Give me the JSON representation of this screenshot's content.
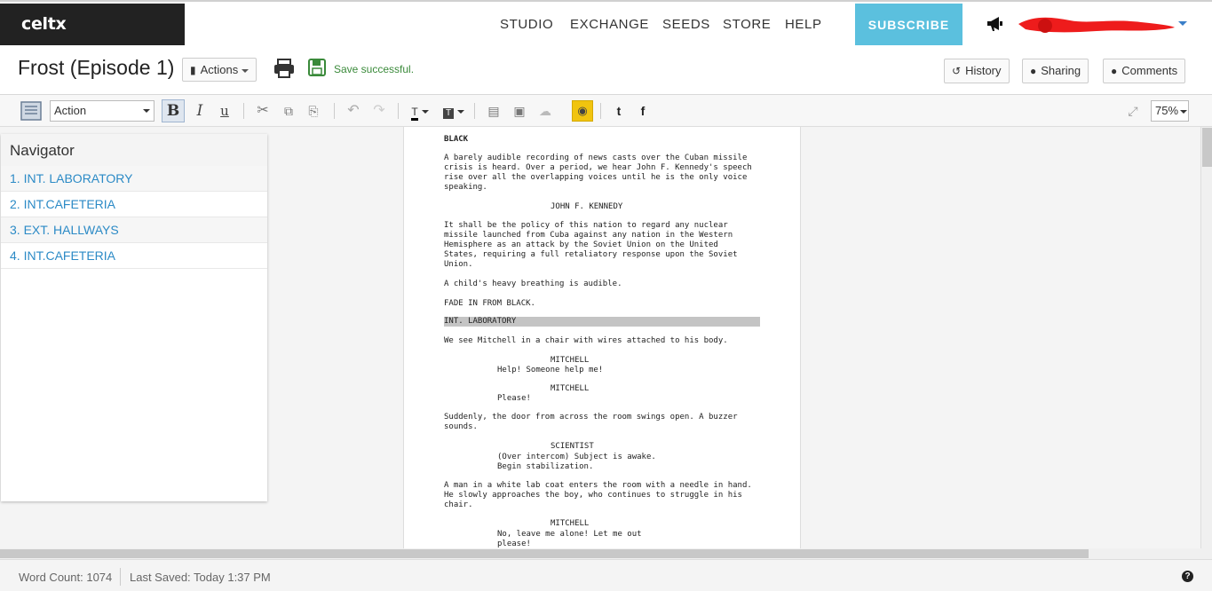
{
  "app": {
    "logo": "celtx",
    "nav": [
      "STUDIO",
      "EXCHANGE",
      "SEEDS",
      "STORE",
      "HELP"
    ],
    "subscribe": "SUBSCRIBE"
  },
  "titlebar": {
    "title": "Frost (Episode 1)",
    "actions_label": "Actions",
    "save_status": "Save successful.",
    "history_label": "History",
    "sharing_label": "Sharing",
    "comments_label": "Comments"
  },
  "toolbar": {
    "element_style": "Action",
    "zoom": "75%"
  },
  "navigator": {
    "title": "Navigator",
    "items": [
      "1. INT. LABORATORY",
      "2. INT.CAFETERIA",
      "3. EXT. HALLWAYS",
      "4. INT.CAFETERIA"
    ]
  },
  "script": {
    "lines": [
      "BLACK",
      "A barely audible recording of news casts over the Cuban missile",
      "crisis is heard. Over a period, we hear John F. Kennedy's speech",
      "rise over all the overlapping voices until he is the only voice",
      "speaking.",
      "JOHN F. KENNEDY",
      "It shall be the policy of this nation to regard any nuclear",
      "missile launched from Cuba against any nation in the Western",
      "Hemisphere as an attack by the Soviet Union on the United",
      "States, requiring a full retaliatory response upon the Soviet",
      "Union.",
      "A child's heavy breathing is audible.",
      "FADE IN FROM BLACK.",
      "INT. LABORATORY",
      "We see Mitchell in a chair with wires attached to his body.",
      "MITCHELL",
      "Help! Someone help me!",
      "MITCHELL",
      "Please!",
      "Suddenly, the door from across the room swings open. A buzzer",
      "sounds.",
      "SCIENTIST",
      "(Over intercom) Subject is awake.",
      "Begin stabilization.",
      "A man in a white lab coat enters the room with a needle in hand.",
      "He slowly approaches the boy, who continues to struggle in his",
      "chair.",
      "MITCHELL",
      "No, leave me alone! Let me out",
      "please!"
    ]
  },
  "status": {
    "word_count": "Word Count: 1074",
    "last_saved": "Last Saved: Today 1:37 PM"
  },
  "colors": {
    "subscribe_bg": "#5bc0de",
    "link": "#2b8ac6",
    "save_green": "#3a8a3a",
    "lock_yellow": "#f1c40f"
  }
}
